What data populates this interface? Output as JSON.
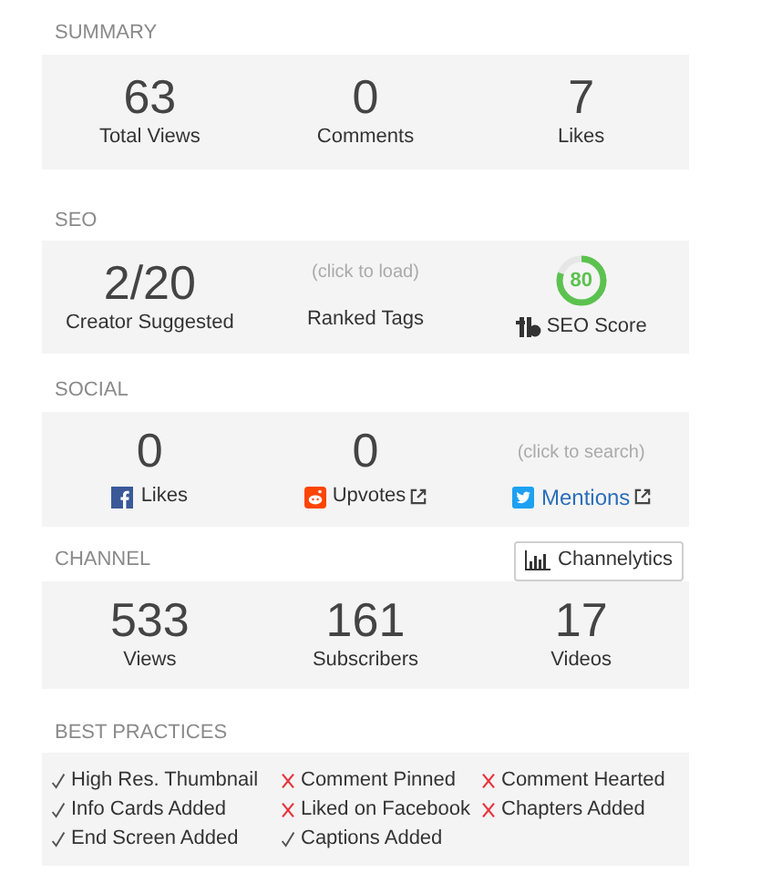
{
  "summary": {
    "heading": "SUMMARY",
    "stats": [
      {
        "value": "63",
        "label": "Total Views"
      },
      {
        "value": "0",
        "label": "Comments"
      },
      {
        "value": "7",
        "label": "Likes"
      }
    ]
  },
  "seo": {
    "heading": "SEO",
    "creator": {
      "value": "2/20",
      "label": "Creator Suggested"
    },
    "ranked": {
      "hint": "(click to load)",
      "label": "Ranked Tags"
    },
    "score": {
      "value": "80",
      "level": 0.8,
      "label": "SEO Score"
    }
  },
  "social": {
    "heading": "SOCIAL",
    "facebook": {
      "value": "0",
      "label": "Likes"
    },
    "reddit": {
      "value": "0",
      "label": "Upvotes"
    },
    "twitter": {
      "hint": "(click to search)",
      "label": "Mentions"
    }
  },
  "channel": {
    "heading": "CHANNEL",
    "button": "Channelytics",
    "stats": [
      {
        "value": "533",
        "label": "Views"
      },
      {
        "value": "161",
        "label": "Subscribers"
      },
      {
        "value": "17",
        "label": "Videos"
      }
    ]
  },
  "best_practices": {
    "heading": "BEST PRACTICES",
    "items": [
      {
        "label": "High Res. Thumbnail",
        "done": true
      },
      {
        "label": "Comment Pinned",
        "done": false
      },
      {
        "label": "Comment Hearted",
        "done": false
      },
      {
        "label": "Info Cards Added",
        "done": true
      },
      {
        "label": "Liked on Facebook",
        "done": false
      },
      {
        "label": "Chapters Added",
        "done": false
      },
      {
        "label": "End Screen Added",
        "done": true
      },
      {
        "label": "Captions Added",
        "done": true
      }
    ]
  }
}
